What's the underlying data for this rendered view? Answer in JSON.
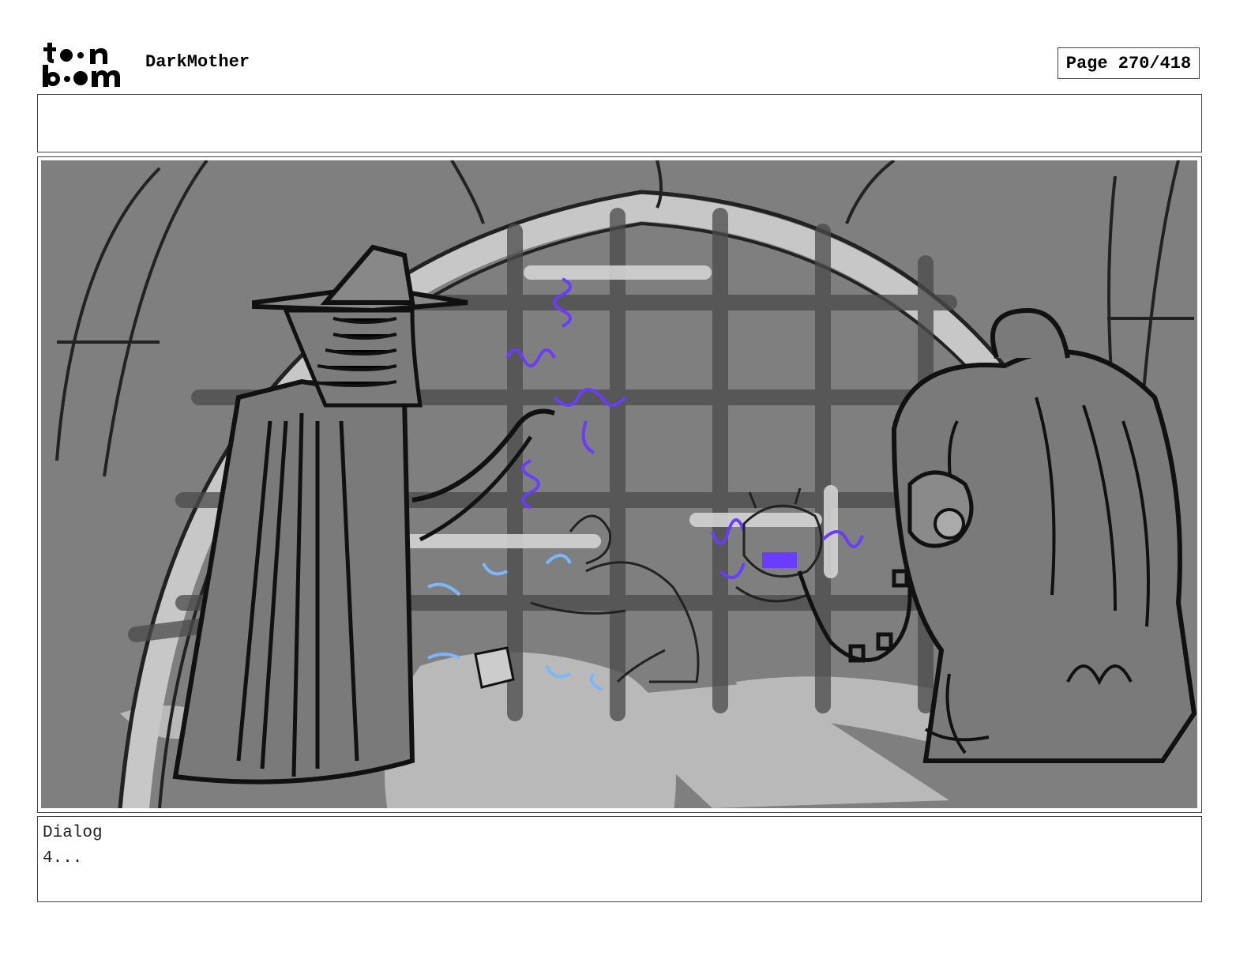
{
  "header": {
    "logo_alt": "toon boom",
    "project_title": "DarkMother",
    "page_label": "Page 270/418"
  },
  "notes": {
    "text": ""
  },
  "panel": {
    "scene_description": "",
    "colors": {
      "background_gray": "#7f7f7f",
      "light_gray": "#bdbdbd",
      "line_black": "#111111",
      "magic_purple": "#6a3cff",
      "effect_blue": "#79b8ff"
    }
  },
  "dialog": {
    "label": "Dialog",
    "text": "4..."
  }
}
